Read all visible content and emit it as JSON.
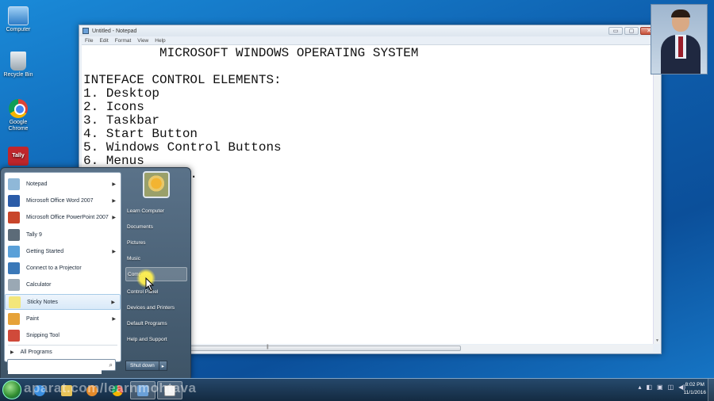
{
  "desktop": {
    "icons": [
      {
        "label": "Computer",
        "icon": "computer-icon"
      },
      {
        "label": "Recycle Bin",
        "icon": "recycle-bin-icon"
      },
      {
        "label": "Google Chrome",
        "icon": "chrome-icon"
      },
      {
        "label": "Tally",
        "icon": "tally-icon"
      }
    ]
  },
  "notepad": {
    "title": "Untitled - Notepad",
    "controls": {
      "minimize": "▭",
      "maximize": "▢",
      "close": "✕"
    },
    "menu": [
      "File",
      "Edit",
      "Format",
      "View",
      "Help"
    ],
    "lines": [
      "          MICROSOFT WINDOWS OPERATING SYSTEM",
      "",
      "INTEFACE CONTROL ELEMENTS:",
      "1. Desktop",
      "2. Icons",
      "3. Taskbar",
      "4. Start Button",
      "5. Windows Control Buttons",
      "6. Menus",
      "          oxes."
    ]
  },
  "start_menu": {
    "programs": [
      {
        "label": "Notepad",
        "icon": "notepad-icon",
        "color": "#8fb8d8",
        "submenu": true
      },
      {
        "label": "Microsoft Office Word 2007",
        "icon": "word-icon",
        "color": "#2b5ca8",
        "submenu": true
      },
      {
        "label": "Microsoft Office PowerPoint 2007",
        "icon": "powerpoint-icon",
        "color": "#c8452a",
        "submenu": true
      },
      {
        "label": "Tally 9",
        "icon": "tally-icon",
        "color": "#5c6b78",
        "submenu": false
      },
      {
        "label": "Getting Started",
        "icon": "getting-started-icon",
        "color": "#5aa0d8",
        "submenu": true
      },
      {
        "label": "Connect to a Projector",
        "icon": "projector-icon",
        "color": "#3a78b8",
        "submenu": false
      },
      {
        "label": "Calculator",
        "icon": "calculator-icon",
        "color": "#9aa8b4",
        "submenu": false
      },
      {
        "label": "Sticky Notes",
        "icon": "sticky-notes-icon",
        "color": "#f3e67a",
        "submenu": true
      },
      {
        "label": "Paint",
        "icon": "paint-icon",
        "color": "#e6a238",
        "submenu": true
      },
      {
        "label": "Snipping Tool",
        "icon": "snipping-tool-icon",
        "color": "#d04a3a",
        "submenu": false
      }
    ],
    "all_programs": "All Programs",
    "search_placeholder": "",
    "right_links": [
      "Learn Computer",
      "Documents",
      "Pictures",
      "Music",
      "Computer",
      "Control Panel",
      "Devices and Printers",
      "Default Programs",
      "Help and Support"
    ],
    "shutdown": "Shut down",
    "shutdown_arrow": "▸"
  },
  "taskbar": {
    "watermark": "aparat.com/learnmohtava",
    "clock_time": "8:02 PM",
    "clock_date": "11/1/2016",
    "tray_icons": [
      "▴",
      "◧",
      "▣",
      "◫",
      "◀)"
    ]
  },
  "colors": {
    "desktop_bg": "#0e5fae",
    "start_menu_bg": "#4a6378",
    "highlight": "#d8e9f8",
    "cursor_halo": "#fff050"
  }
}
